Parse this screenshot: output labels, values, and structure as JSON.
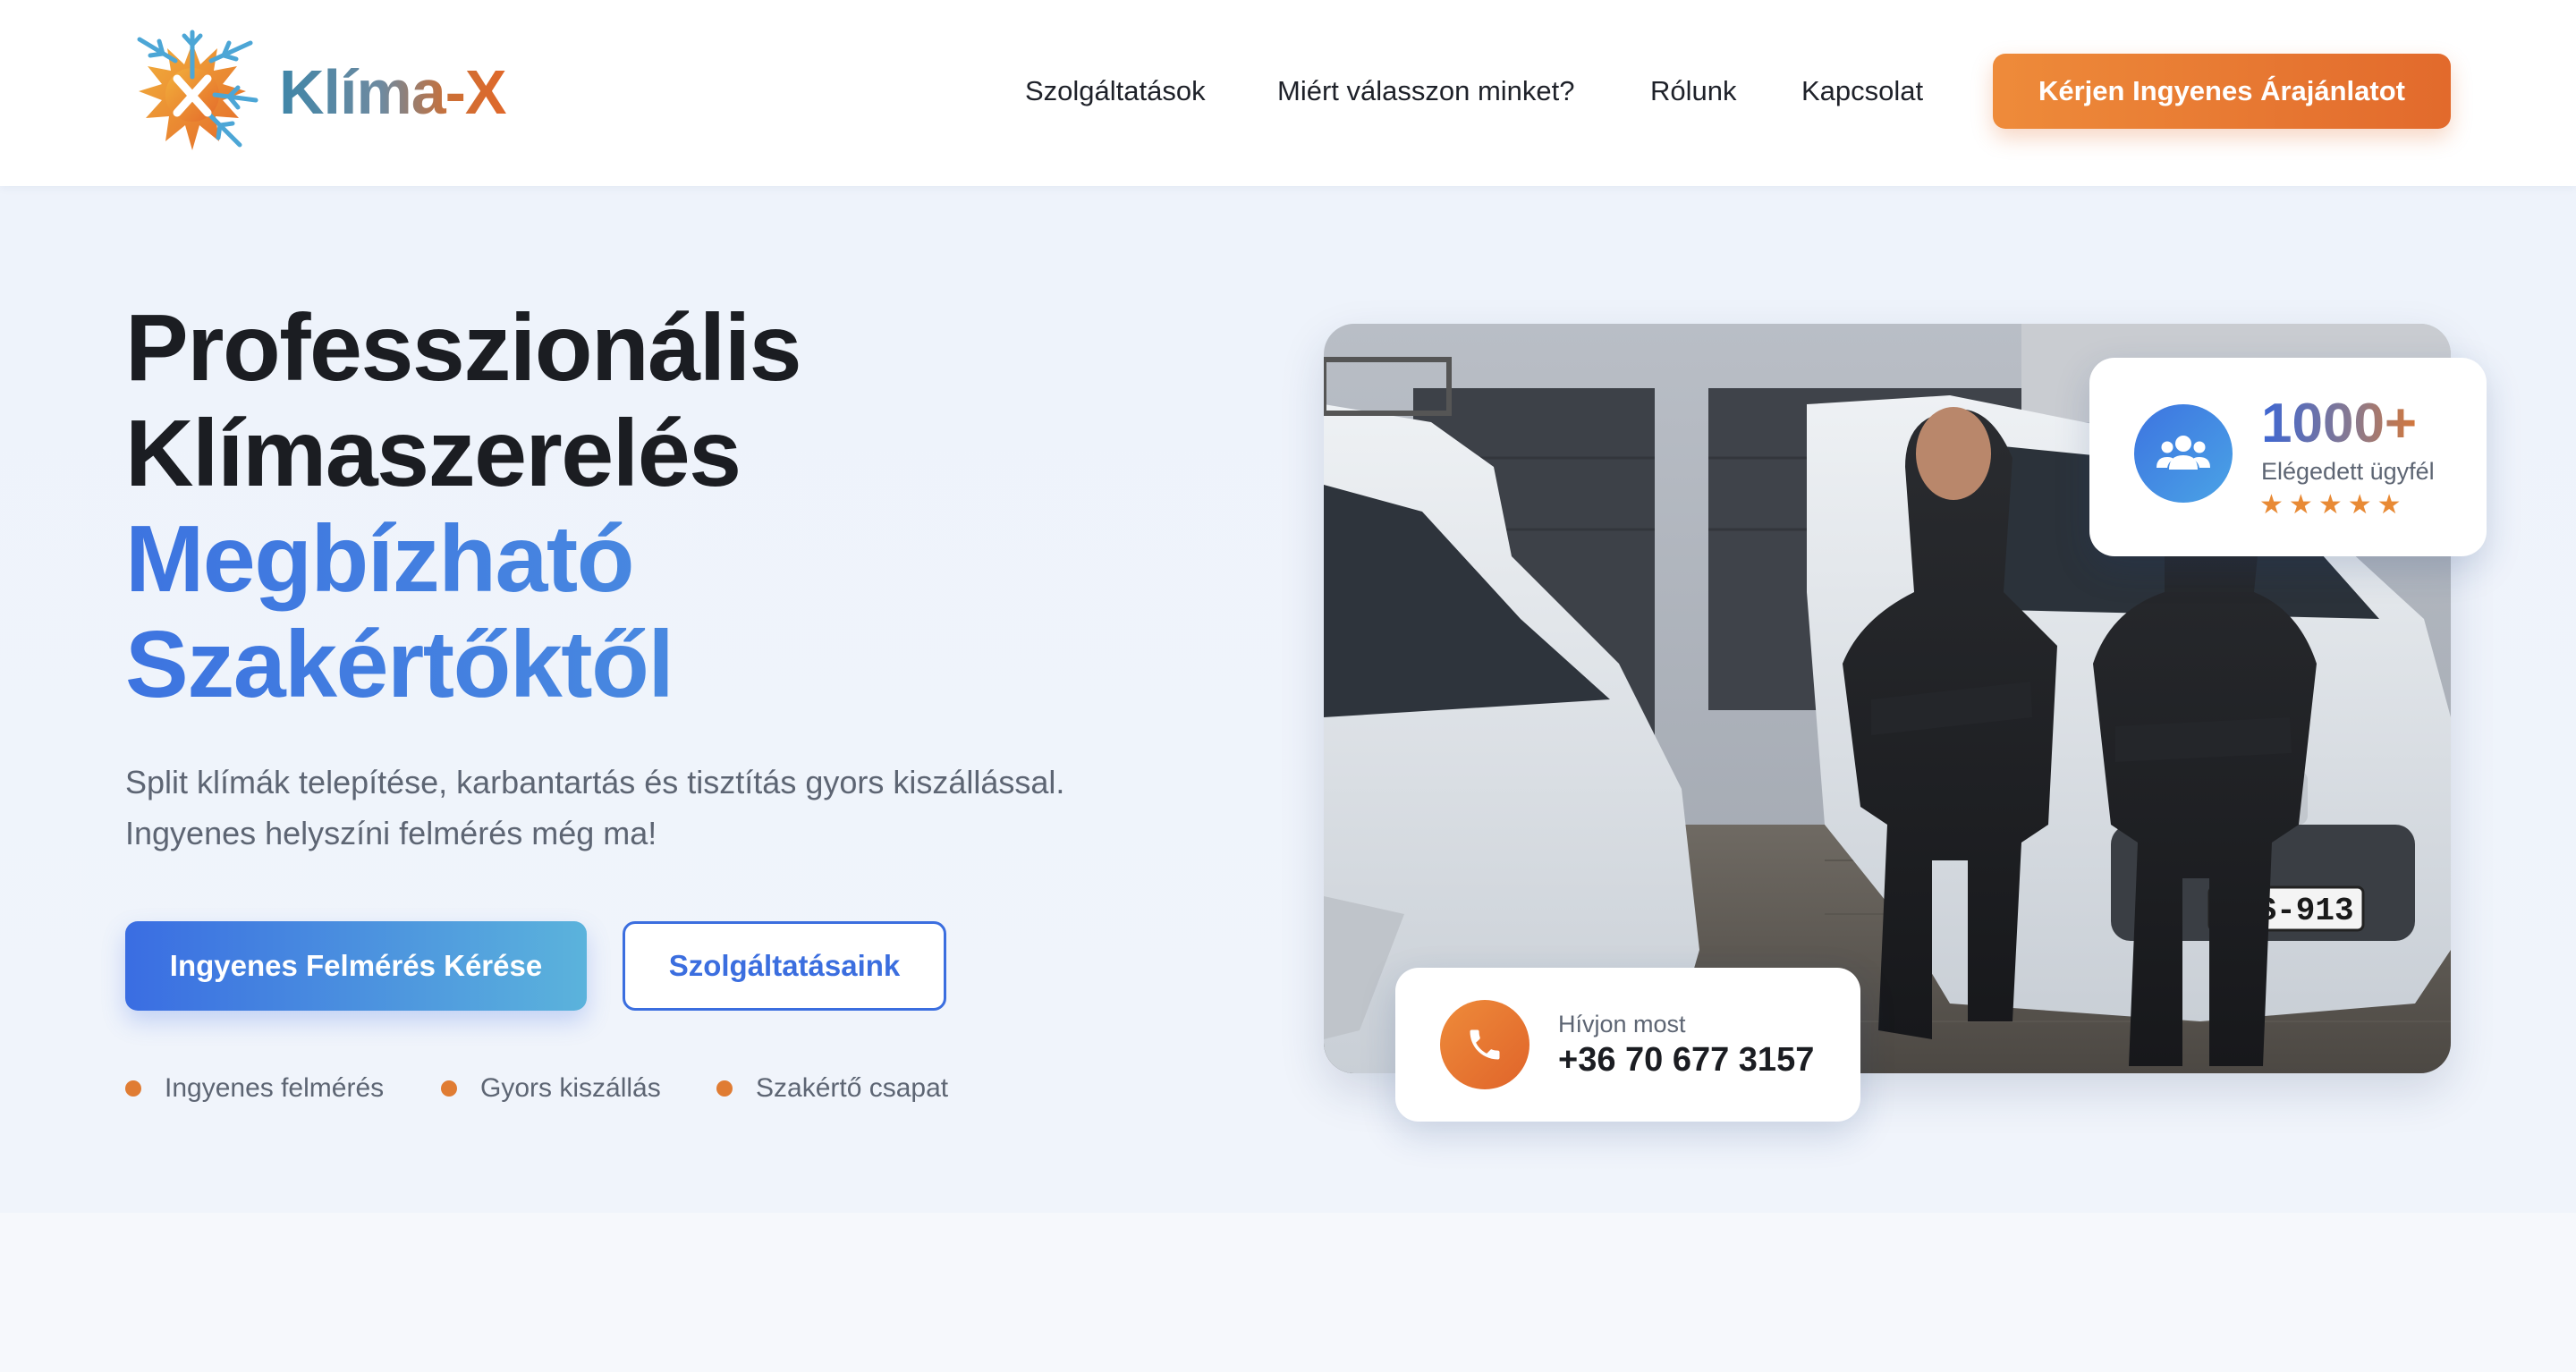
{
  "brand": {
    "name_main": "Klíma",
    "name_suffix": "-X"
  },
  "nav": {
    "items": [
      {
        "label": "Szolgáltatások"
      },
      {
        "label": "Miért válasszon minket?"
      },
      {
        "label": "Rólunk"
      },
      {
        "label": "Kapcsolat"
      }
    ],
    "cta_label": "Kérjen Ingyenes Árajánlatot"
  },
  "hero": {
    "title_line1": "Professzionális",
    "title_line2": "Klímaszerelés",
    "title_highlight_line1": "Megbízható",
    "title_highlight_line2": "Szakértőktől",
    "subtitle_line1": "Split klímák telepítése, karbantartás és tisztítás gyors kiszállással.",
    "subtitle_line2": "Ingyenes helyszíni felmérés még ma!",
    "primary_button": "Ingyenes Felmérés Kérése",
    "secondary_button": "Szolgáltatásaink",
    "features": [
      {
        "label": "Ingyenes felmérés"
      },
      {
        "label": "Gyors kiszállás"
      },
      {
        "label": "Szakértő csapat"
      }
    ]
  },
  "stat_card": {
    "value": "1000+",
    "label": "Elégedett ügyfél",
    "rating": 5,
    "icon": "users-icon"
  },
  "call_card": {
    "label": "Hívjon most",
    "phone": "+36 70 677 3157",
    "icon": "phone-icon"
  },
  "photo": {
    "license_plate": "LOS-913"
  },
  "colors": {
    "accent_blue": "#3d74e0",
    "accent_orange": "#e26a2c",
    "text_dark": "#1b1d22",
    "text_muted": "#5d6573",
    "hero_bg": "#eef3fb"
  }
}
